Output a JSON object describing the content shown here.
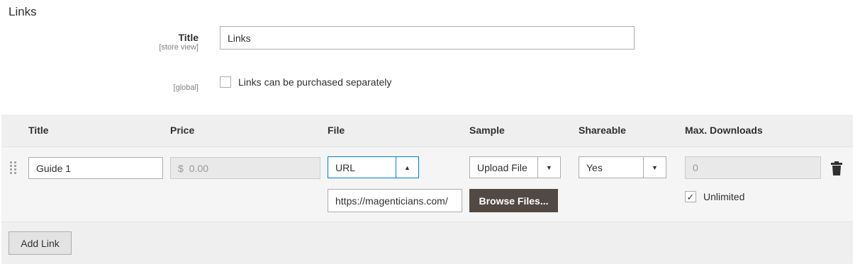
{
  "section": {
    "title": "Links"
  },
  "title_field": {
    "label": "Title",
    "scope": "[store view]",
    "value": "Links"
  },
  "separate_field": {
    "scope": "[global]",
    "checkbox_label": "Links can be purchased separately",
    "checked": false
  },
  "grid": {
    "headers": {
      "title": "Title",
      "price": "Price",
      "file": "File",
      "sample": "Sample",
      "shareable": "Shareable",
      "max_downloads": "Max. Downloads"
    },
    "row": {
      "title": "Guide 1",
      "price_symbol": "$",
      "price_placeholder": "0.00",
      "file_type": "URL",
      "file_url": "https://magenticians.com/",
      "sample_type": "Upload File",
      "browse_label": "Browse Files...",
      "shareable": "Yes",
      "max_downloads_placeholder": "0",
      "unlimited_label": "Unlimited",
      "unlimited_checked": true
    }
  },
  "add_link_label": "Add Link",
  "icons": {
    "drag": "drag-handle-icon",
    "delete": "trash-icon",
    "check": "check-icon",
    "arrow_up": "arrow-up-icon",
    "arrow_down": "arrow-down-icon"
  },
  "colors": {
    "primary_button": "#514943",
    "focus_border": "#007bdb",
    "grid_bg": "#efefef"
  }
}
